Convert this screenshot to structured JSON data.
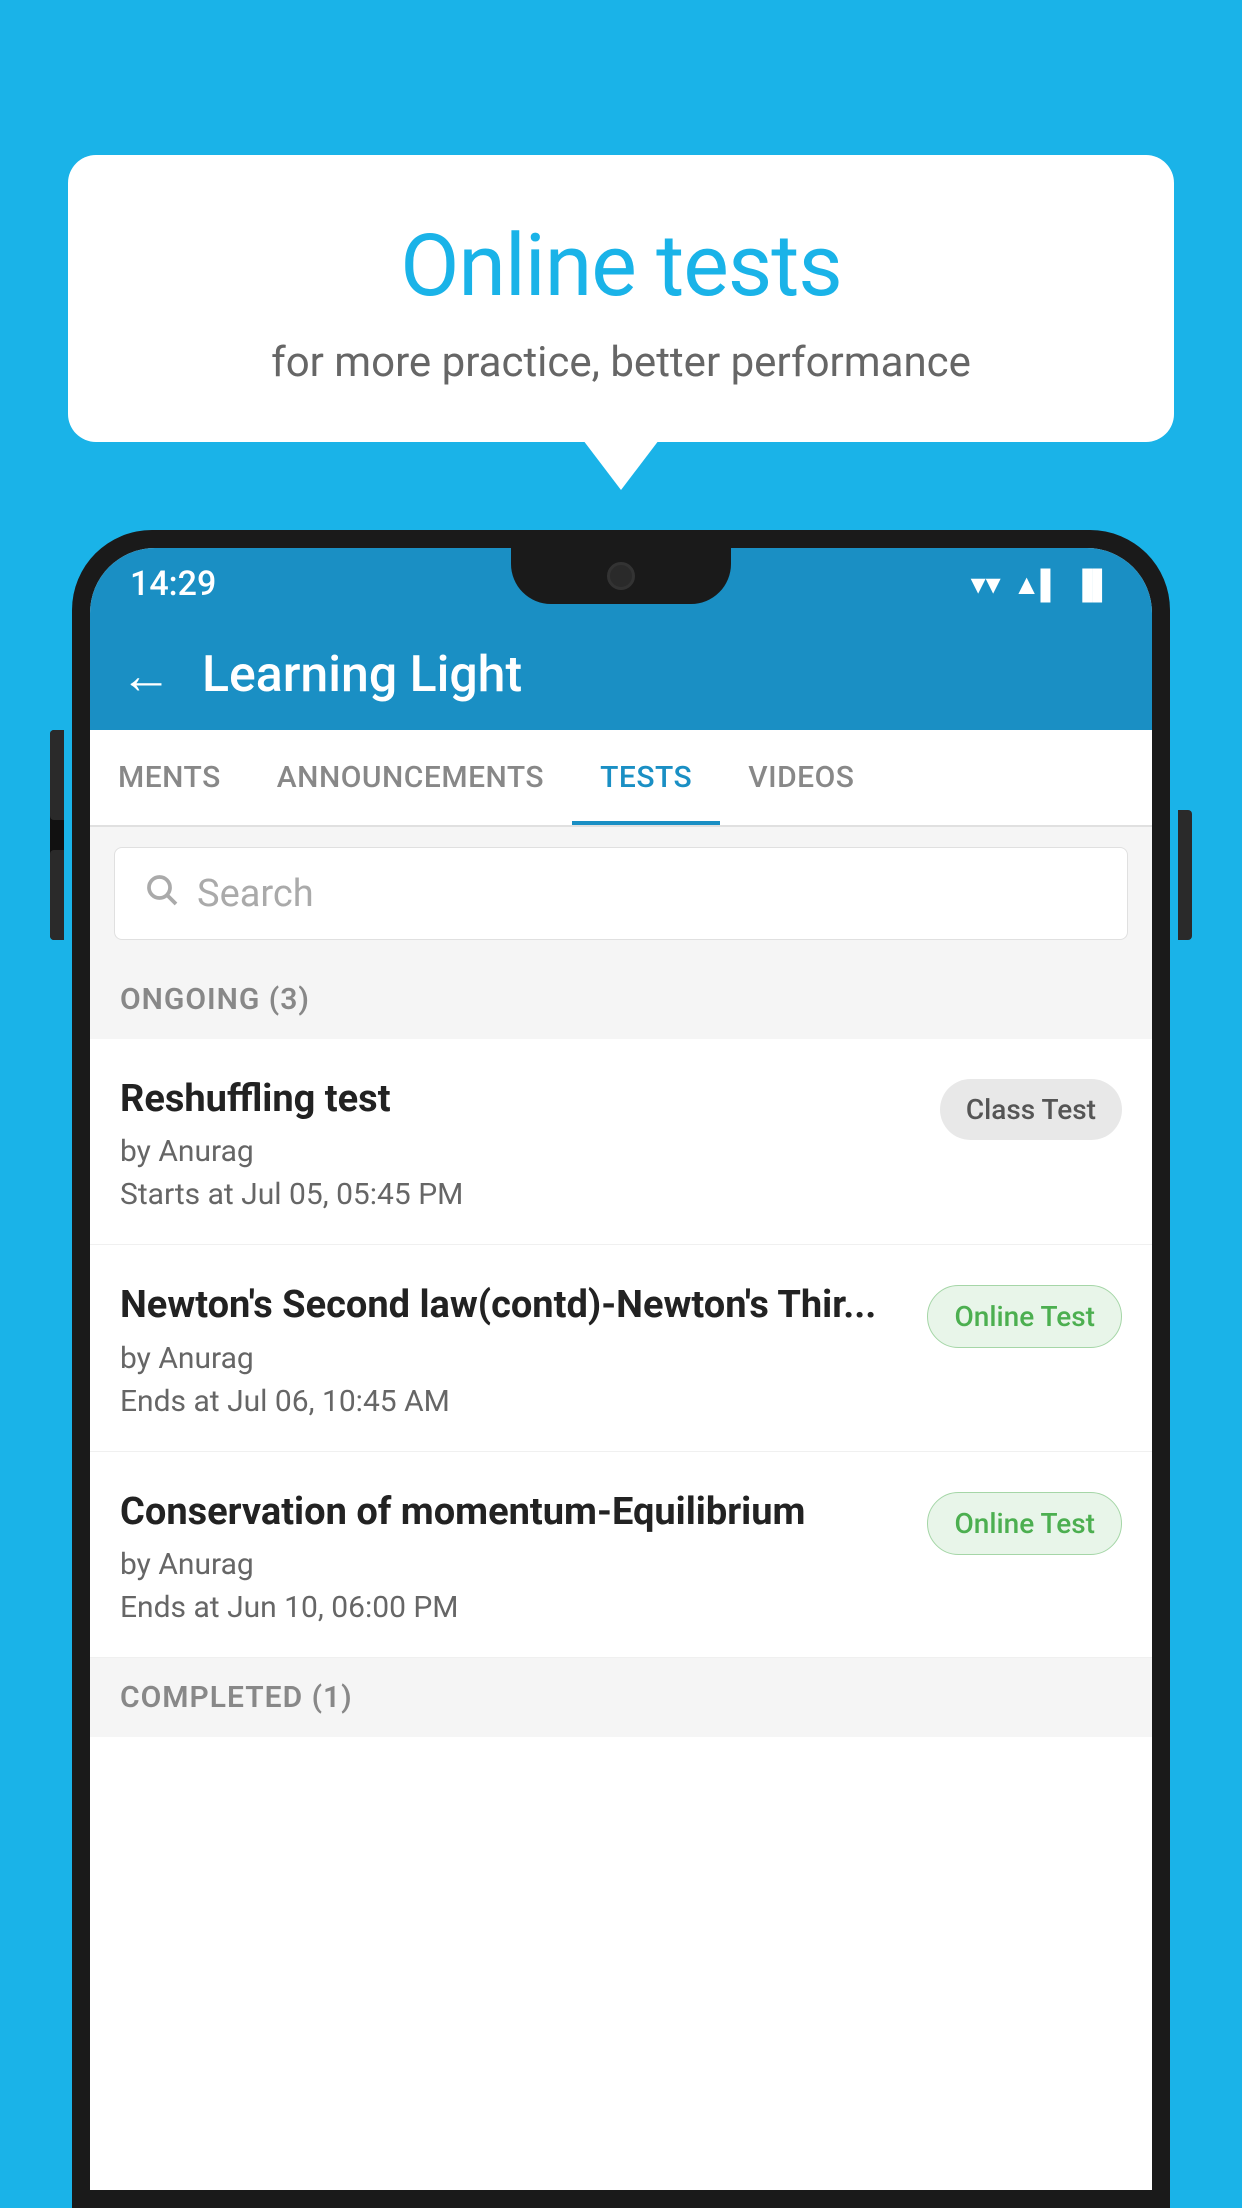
{
  "background_color": "#1ab3e8",
  "bubble": {
    "title": "Online tests",
    "subtitle": "for more practice, better performance"
  },
  "status_bar": {
    "time": "14:29",
    "wifi": "▼",
    "signal": "▲",
    "battery": "▌"
  },
  "app_header": {
    "back_label": "←",
    "title": "Learning Light"
  },
  "tabs": [
    {
      "label": "MENTS",
      "active": false
    },
    {
      "label": "ANNOUNCEMENTS",
      "active": false
    },
    {
      "label": "TESTS",
      "active": true
    },
    {
      "label": "VIDEOS",
      "active": false
    }
  ],
  "search": {
    "placeholder": "Search"
  },
  "ongoing_section": {
    "title": "ONGOING (3)"
  },
  "tests": [
    {
      "name": "Reshuffling test",
      "author": "by Anurag",
      "time_label": "Starts at",
      "time": "Jul 05, 05:45 PM",
      "badge": "Class Test",
      "badge_type": "class"
    },
    {
      "name": "Newton's Second law(contd)-Newton's Thir...",
      "author": "by Anurag",
      "time_label": "Ends at",
      "time": "Jul 06, 10:45 AM",
      "badge": "Online Test",
      "badge_type": "online"
    },
    {
      "name": "Conservation of momentum-Equilibrium",
      "author": "by Anurag",
      "time_label": "Ends at",
      "time": "Jun 10, 06:00 PM",
      "badge": "Online Test",
      "badge_type": "online"
    }
  ],
  "completed_section": {
    "title": "COMPLETED (1)"
  }
}
